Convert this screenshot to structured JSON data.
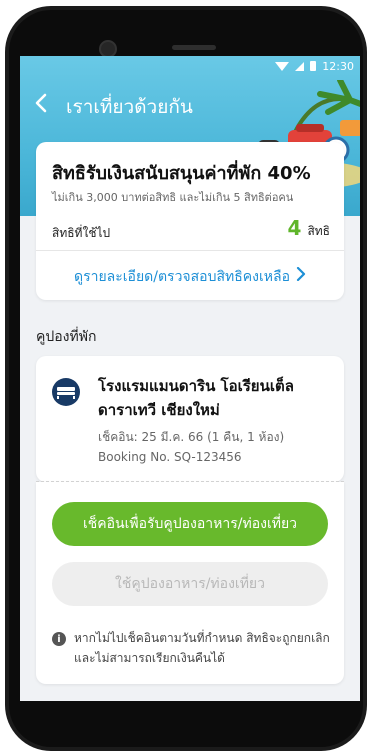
{
  "status_bar": {
    "time": "12:30"
  },
  "header": {
    "title": "เราเที่ยวด้วยกัน"
  },
  "entitlement": {
    "title": "สิทธิรับเงินสนับสนุนค่าที่พัก 40%",
    "subtitle": "ไม่เกิน 3,000 บาทต่อสิทธิ และไม่เกิน 5 สิทธิต่อคน",
    "used_label": "สิทธิที่ใช้ไป",
    "used_count": "4",
    "used_unit": "สิทธิ",
    "details_link": "ดูรายละเอียด/ตรวจสอบสิทธิคงเหลือ"
  },
  "section": {
    "label": "คูปองที่พัก"
  },
  "hotel": {
    "name": "โรงแรมแมนดาริน โอเรียนเต็ล ดาราเทวี เชียงใหม่",
    "checkin": "เช็คอิน: 25 มี.ค. 66 (1 คืน, 1 ห้อง)",
    "booking": "Booking No. SQ-123456"
  },
  "actions": {
    "checkin_button": "เช็คอินเพื่อรับคูปองอาหาร/ท่องเที่ยว",
    "use_coupon_button": "ใช้คูปองอาหาร/ท่องเที่ยว"
  },
  "notice": {
    "text": "หากไม่ไปเช็คอินตามวันที่กำหนด สิทธิจะถูกยกเลิก และไม่สามารถเรียกเงินคืนได้"
  },
  "colors": {
    "accent_green": "#68b92c",
    "link_blue": "#1d8fd6",
    "header_blue": "#4cb7d9"
  }
}
